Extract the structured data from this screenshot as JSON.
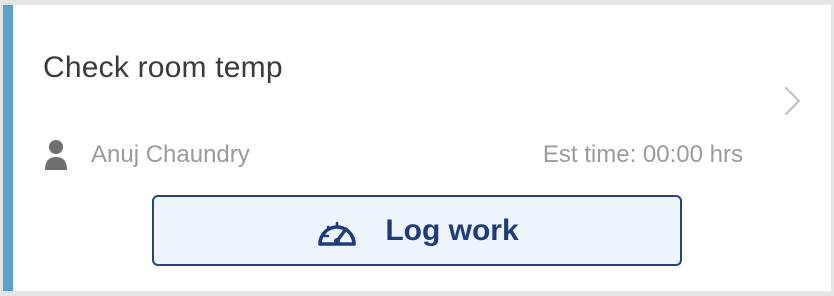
{
  "task": {
    "title": "Check room temp",
    "assignee": "Anuj Chaundry",
    "est_time": "Est time: 00:00 hrs"
  },
  "actions": {
    "log_work_label": "Log work"
  },
  "icons": {
    "assignee": "person-icon",
    "log_work": "speedometer-icon",
    "open": "chevron-right-icon"
  },
  "colors": {
    "accent": "#5ba3c9",
    "button_border": "#28447e",
    "button_background": "#eef4fb",
    "button_text": "#1f3c7a",
    "secondary_text": "#9a9a9a",
    "title_text": "#3a3a3a"
  }
}
